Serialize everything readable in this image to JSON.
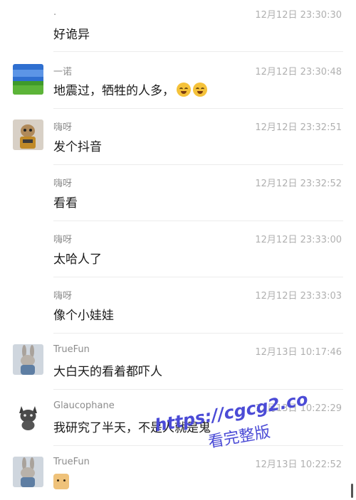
{
  "messages": [
    {
      "name": ".",
      "time": "12月12日 23:30:30",
      "text": "好诡异",
      "avatar": ""
    },
    {
      "name": "一诺",
      "time": "12月12日 23:30:48",
      "text": "地震过，牺牲的人多，",
      "avatar": "landscape",
      "emoji_count": 2
    },
    {
      "name": "嗨呀",
      "time": "12月12日 23:32:51",
      "text": "发个抖音",
      "avatar": "toy-figure"
    },
    {
      "name": "嗨呀",
      "time": "12月12日 23:32:52",
      "text": "看看",
      "avatar": ""
    },
    {
      "name": "嗨呀",
      "time": "12月12日 23:33:00",
      "text": "太哈人了",
      "avatar": ""
    },
    {
      "name": "嗨呀",
      "time": "12月12日 23:33:03",
      "text": "像个小娃娃",
      "avatar": ""
    },
    {
      "name": "TrueFun",
      "time": "12月13日 10:17:46",
      "text": "大白天的看着都吓人",
      "avatar": "bunny"
    },
    {
      "name": "Glaucophane",
      "time": "12月13日 10:22:29",
      "text": "我研究了半天，不是人就是鬼",
      "avatar": "cat"
    },
    {
      "name": "TrueFun",
      "time": "12月13日 10:22:52",
      "text": "",
      "avatar": "bunny",
      "emoji": "doge"
    }
  ],
  "watermark": {
    "url": "https://cgcg2.co",
    "label": "看完整版"
  }
}
